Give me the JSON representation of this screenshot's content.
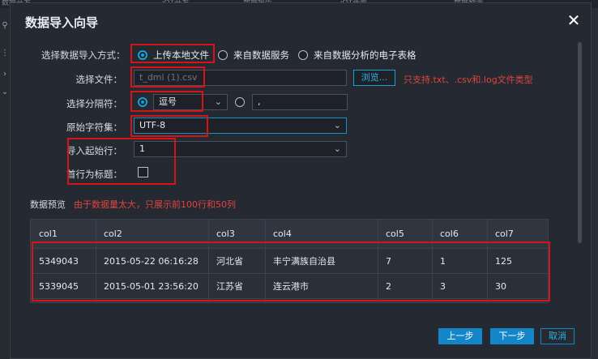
{
  "background": {
    "tabs": [
      "数据开发",
      "iOT开发",
      "数据报告",
      "iOT画面",
      "数据预测"
    ]
  },
  "dialog": {
    "title": "数据导入向导",
    "import_method": {
      "label": "选择数据导入方式：",
      "options": [
        "上传本地文件",
        "来自数据服务",
        "来自数据分析的电子表格"
      ],
      "selected": "上传本地文件"
    },
    "file": {
      "label": "选择文件：",
      "value": "t_dml (1).csv",
      "browse_label": "浏览...",
      "note": "只支持.txt、.csv和.log文件类型"
    },
    "delimiter": {
      "label": "选择分隔符：",
      "value": "逗号",
      "custom_value": ","
    },
    "charset": {
      "label": "原始字符集：",
      "value": "UTF-8"
    },
    "start_row": {
      "label": "导入起始行：",
      "value": "1"
    },
    "header_row": {
      "label": "首行为标题：",
      "checked": false
    },
    "preview": {
      "label": "数据预览",
      "note": "由于数据量太大，只展示前100行和50列",
      "columns": [
        "col1",
        "col2",
        "col3",
        "col4",
        "col5",
        "col6",
        "col7"
      ],
      "rows": [
        [
          "5349043",
          "2015-05-22 06:16:28",
          "河北省",
          "丰宁满族自治县",
          "7",
          "1",
          "125"
        ],
        [
          "5339045",
          "2015-05-01 23:56:20",
          "江苏省",
          "连云港市",
          "2",
          "3",
          "30"
        ]
      ]
    },
    "buttons": {
      "prev": "上一步",
      "next": "下一步",
      "cancel": "取消"
    }
  },
  "colors": {
    "accent": "#12a4d4",
    "primary_button": "#1386c9",
    "warning_text": "#e0453e",
    "highlight_box": "#d4141a",
    "dialog_bg": "#252931"
  }
}
